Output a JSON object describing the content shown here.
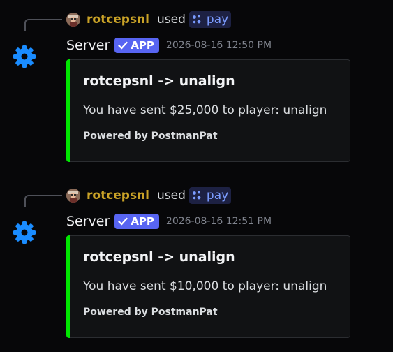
{
  "messages": [
    {
      "reply": {
        "username": "rotcepsnl",
        "used_text": "used",
        "command": "pay"
      },
      "author": "Server",
      "badge": "APP",
      "timestamp": "2026-08-16 12:50 PM",
      "embed": {
        "title": "rotcepsnl -> unalign",
        "description": "You have sent $25,000 to player: unalign",
        "footer": "Powered by PostmanPat"
      }
    },
    {
      "reply": {
        "username": "rotcepsnl",
        "used_text": "used",
        "command": "pay"
      },
      "author": "Server",
      "badge": "APP",
      "timestamp": "2026-08-16 12:51 PM",
      "embed": {
        "title": "rotcepsnl -> unalign",
        "description": "You have sent $10,000 to player: unalign",
        "footer": "Powered by PostmanPat"
      }
    }
  ],
  "colors": {
    "background": "#070709",
    "username": "#c9a227",
    "command_text": "#7b9cff",
    "app_badge": "#5865f2",
    "embed_accent": "#00e600",
    "embed_background": "#111214",
    "bot_avatar": "#1a8cff"
  },
  "icons": {
    "bot_avatar": "gear-icon",
    "command": "grid-icon",
    "badge": "check-icon"
  }
}
